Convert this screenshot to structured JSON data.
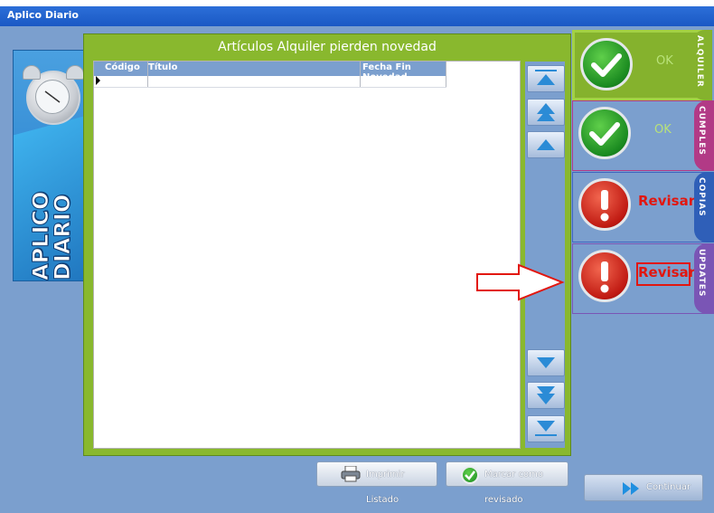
{
  "window": {
    "title": "Aplico Diario"
  },
  "banner": {
    "text_line1": "APLICO",
    "text_line2": "DIARIO"
  },
  "panel": {
    "title": "Artículos Alquiler pierden novedad"
  },
  "grid": {
    "columns": [
      "Código",
      "Título",
      "Fecha Fin Novedad"
    ],
    "rows": []
  },
  "scroll": {
    "buttons": [
      "first-icon",
      "page-up-icon",
      "up-icon",
      "down-icon",
      "page-down-icon",
      "last-icon"
    ]
  },
  "tabs": [
    {
      "label": "ALQUILER",
      "status": "OK",
      "icon": "ok-icon",
      "color": "#85b22d"
    },
    {
      "label": "CUMPLES",
      "status": "OK",
      "icon": "ok-icon",
      "color": "#b23a86"
    },
    {
      "label": "COPIAS",
      "status": "Revisar",
      "icon": "warning-icon",
      "color": "#2f5fb8"
    },
    {
      "label": "UPDATES",
      "status": "Revisar",
      "icon": "warning-icon",
      "color": "#7a55b5"
    }
  ],
  "buttons": {
    "print": "Imprimir Listado",
    "mark": "Marcar como revisado",
    "continue": "Continuar"
  },
  "colors": {
    "background": "#7b9fce",
    "titlebar": "#1a58c4",
    "accent_green": "#89b82e",
    "warning_red": "#e2170f"
  }
}
